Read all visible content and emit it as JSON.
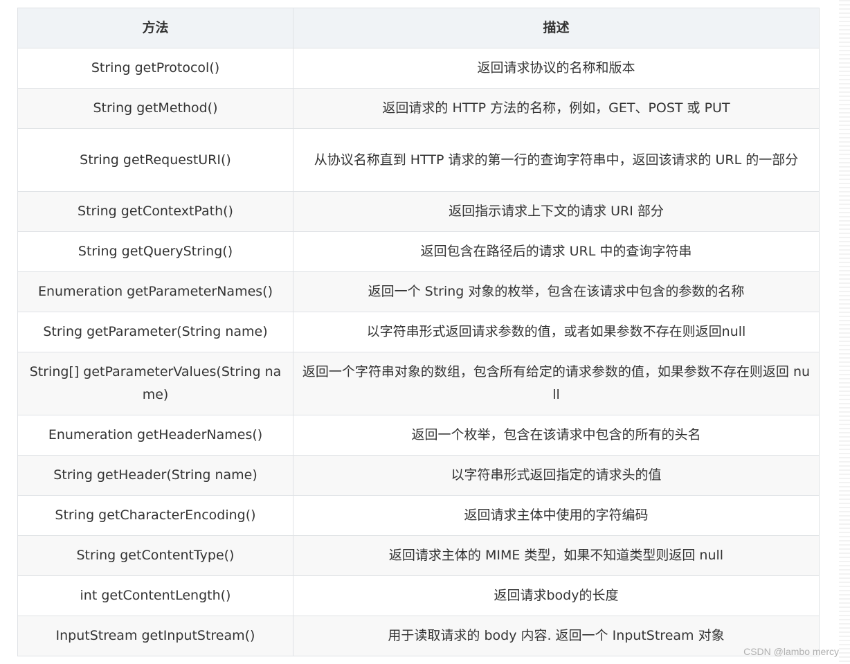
{
  "table": {
    "headers": [
      "方法",
      "描述"
    ],
    "rows": [
      {
        "method": "String getProtocol()",
        "desc": "返回请求协议的名称和版本"
      },
      {
        "method": "String getMethod()",
        "desc": "返回请求的 HTTP 方法的名称，例如，GET、POST 或 PUT"
      },
      {
        "method": "String getRequestURI()",
        "desc": "从协议名称直到 HTTP 请求的第一行的查询字符串中，返回该请求的 URL 的一部分"
      },
      {
        "method": "String getContextPath()",
        "desc": "返回指示请求上下文的请求 URI 部分"
      },
      {
        "method": "String getQueryString()",
        "desc": "返回包含在路径后的请求 URL 中的查询字符串"
      },
      {
        "method": "Enumeration getParameterNames()",
        "desc": "返回一个 String 对象的枚举，包含在该请求中包含的参数的名称"
      },
      {
        "method": "String getParameter(String name)",
        "desc": "以字符串形式返回请求参数的值，或者如果参数不存在则返回null"
      },
      {
        "method": "String[] getParameterValues(String name)",
        "desc": "返回一个字符串对象的数组，包含所有给定的请求参数的值，如果参数不存在则返回 null"
      },
      {
        "method": "Enumeration getHeaderNames()",
        "desc": "返回一个枚举，包含在该请求中包含的所有的头名"
      },
      {
        "method": "String getHeader(String name)",
        "desc": "以字符串形式返回指定的请求头的值"
      },
      {
        "method": "String getCharacterEncoding()",
        "desc": "返回请求主体中使用的字符编码"
      },
      {
        "method": "String getContentType()",
        "desc": "返回请求主体的 MIME 类型，如果不知道类型则返回 null"
      },
      {
        "method": "int getContentLength()",
        "desc": "返回请求body的长度"
      },
      {
        "method": "InputStream getInputStream()",
        "desc": "用于读取请求的 body 内容. 返回一个 InputStream 对象"
      }
    ]
  },
  "watermark": "CSDN @lambo mercy"
}
